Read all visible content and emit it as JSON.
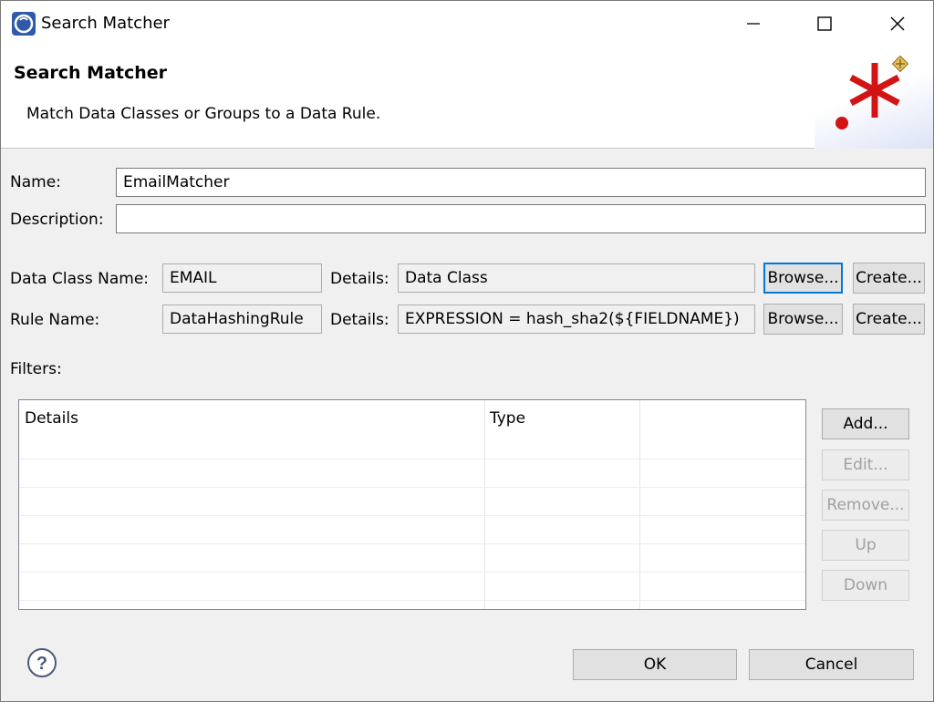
{
  "window": {
    "title": "Search Matcher",
    "minimize_icon": "minimize-icon",
    "maximize_icon": "maximize-icon",
    "close_icon": "close-icon"
  },
  "banner": {
    "title": "Search Matcher",
    "description": "Match Data Classes or Groups to a Data Rule."
  },
  "form": {
    "name_label": "Name:",
    "name_value": "EmailMatcher",
    "description_label": "Description:",
    "description_value": "",
    "data_class_label": "Data Class Name:",
    "data_class_value": "EMAIL",
    "data_class_details_label": "Details:",
    "data_class_details_value": "Data Class",
    "rule_label": "Rule Name:",
    "rule_value": "DataHashingRule",
    "rule_details_label": "Details:",
    "rule_details_value": "EXPRESSION = hash_sha2(${FIELDNAME})",
    "browse_label": "Browse...",
    "create_label": "Create..."
  },
  "filters": {
    "label": "Filters:",
    "columns": [
      "Details",
      "Type"
    ],
    "rows": [],
    "buttons": {
      "add": "Add...",
      "edit": "Edit...",
      "remove": "Remove...",
      "up": "Up",
      "down": "Down"
    }
  },
  "footer": {
    "ok_label": "OK",
    "cancel_label": "Cancel",
    "help_icon": "help-icon"
  },
  "colors": {
    "accent": "#0078d7",
    "banner_star": "#d21414",
    "window_bg": "#f0f0f0"
  }
}
